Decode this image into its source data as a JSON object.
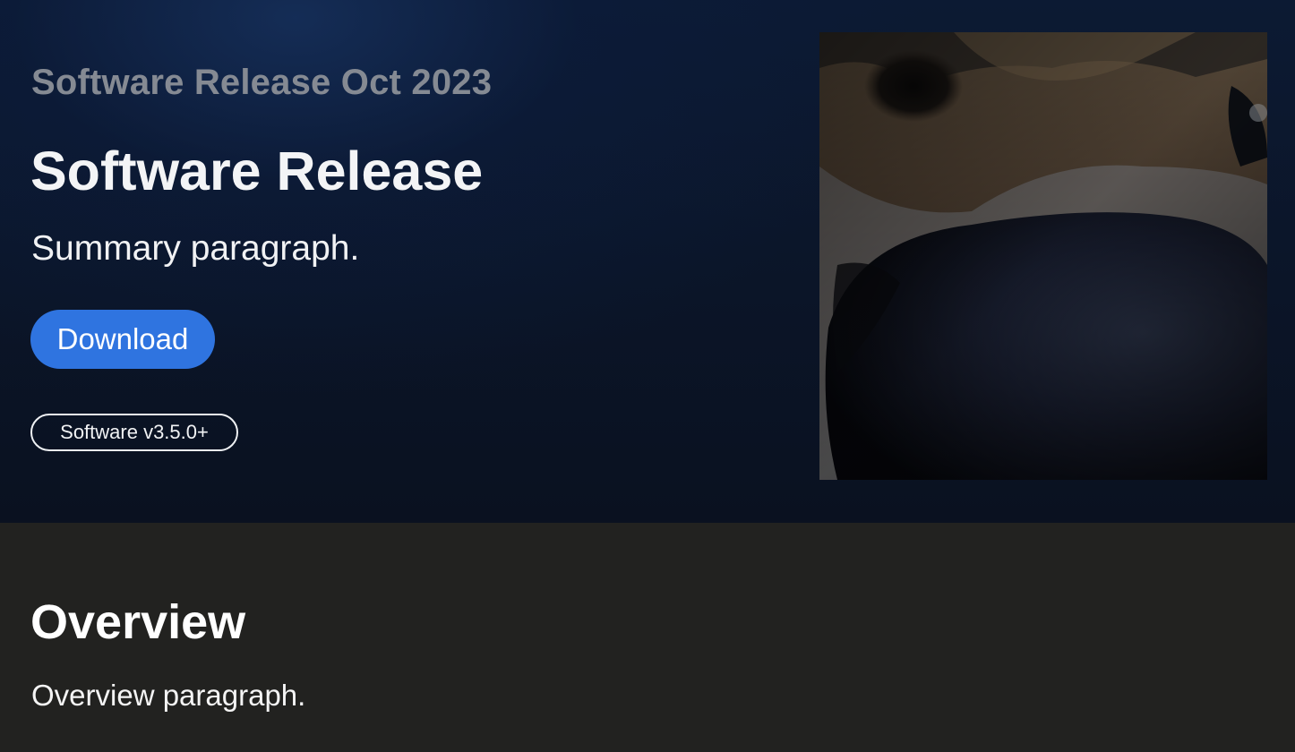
{
  "hero": {
    "eyebrow": "Software Release Oct 2023",
    "title": "Software Release",
    "summary": "Summary paragraph.",
    "download_label": "Download",
    "version_badge": "Software v3.5.0+",
    "image_subject": "dog-nose-closeup-photo"
  },
  "overview": {
    "title": "Overview",
    "paragraph": "Overview paragraph."
  },
  "colors": {
    "hero_background": "#0b1528",
    "page_background": "#222220",
    "accent_button": "#2f74e0",
    "eyebrow_text": "#858a93"
  }
}
